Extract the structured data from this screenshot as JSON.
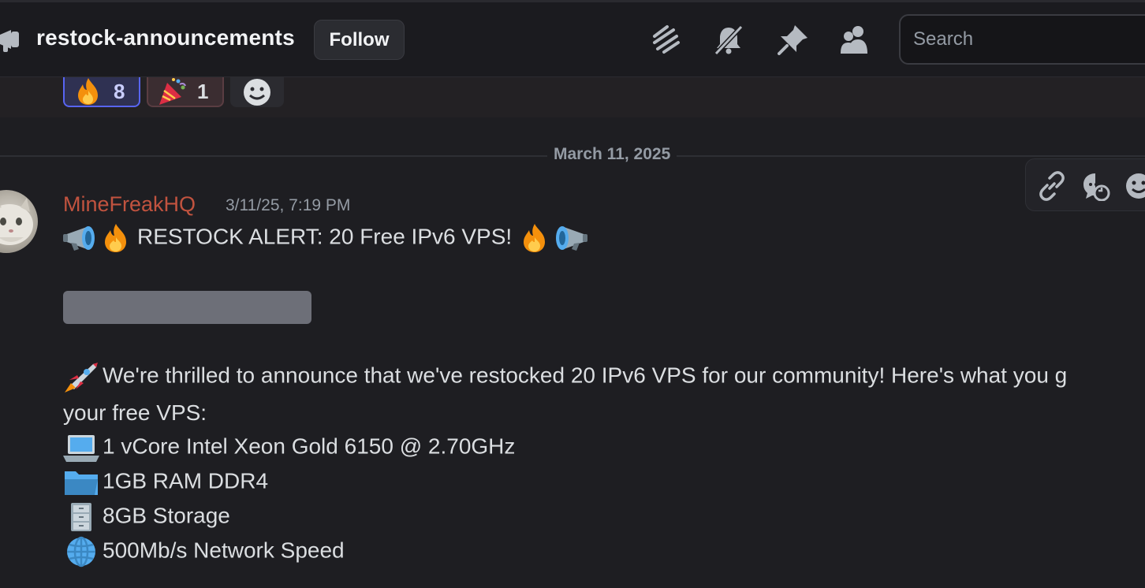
{
  "header": {
    "channel_name": "restock-announcements",
    "follow_label": "Follow",
    "icons": [
      "threads-icon",
      "mute-bell-icon",
      "pin-icon",
      "members-icon"
    ],
    "search_placeholder": "Search"
  },
  "reactions": [
    {
      "emoji": "fire",
      "count": "8",
      "selected": true
    },
    {
      "emoji": "party-popper",
      "count": "1",
      "selected": false
    },
    {
      "emoji": "add-reaction",
      "count": ""
    }
  ],
  "date_divider": "March 11, 2025",
  "message": {
    "username": "MineFreakHQ",
    "username_color": "#c1533f",
    "timestamp": "3/11/25, 7:19 PM",
    "title": "RESTOCK ALERT: 20 Free IPv6 VPS!",
    "intro_line1": "We're thrilled to announce that we've restocked 20 IPv6 VPS for our community! Here's what you g",
    "intro_line2": "your free VPS:",
    "specs": [
      {
        "icon": "laptop",
        "text": "1 vCore Intel Xeon Gold 6150 @ 2.70GHz"
      },
      {
        "icon": "folder",
        "text": "1GB RAM DDR4"
      },
      {
        "icon": "file-cabinet",
        "text": "8GB Storage"
      },
      {
        "icon": "globe",
        "text": "500Mb/s Network Speed"
      }
    ]
  },
  "hover_toolbar": [
    "link-icon",
    "reply-thread-icon",
    "add-reaction-icon"
  ],
  "colors": {
    "accent": "#5865f2",
    "background": "#1e1e22",
    "header": "#1b1b1f"
  }
}
